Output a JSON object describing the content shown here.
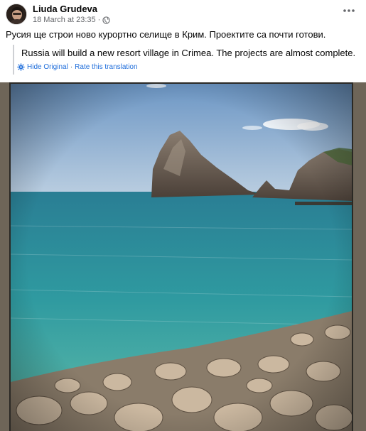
{
  "post": {
    "author": "Liuda Grudeva",
    "timestamp": "18 March at 23:35",
    "meta_separator": "·",
    "more_icon": "more-horizontal-icon",
    "text": "Русия ще строи ново курортно селище в Крим. Проектите са почти готови."
  },
  "translation": {
    "text": "Russia will build a new resort village in Crimea. The projects are almost complete.",
    "hide_label": "Hide Original",
    "separator": "·",
    "rate_label": "Rate this translation"
  },
  "photo": {
    "subject": "sea cove with rock and pebble beach",
    "colors": {
      "sky": "#8fb3d6",
      "sea": "#2f8e97",
      "rock": "#7a6a5c",
      "frame": "#6e6558"
    }
  }
}
